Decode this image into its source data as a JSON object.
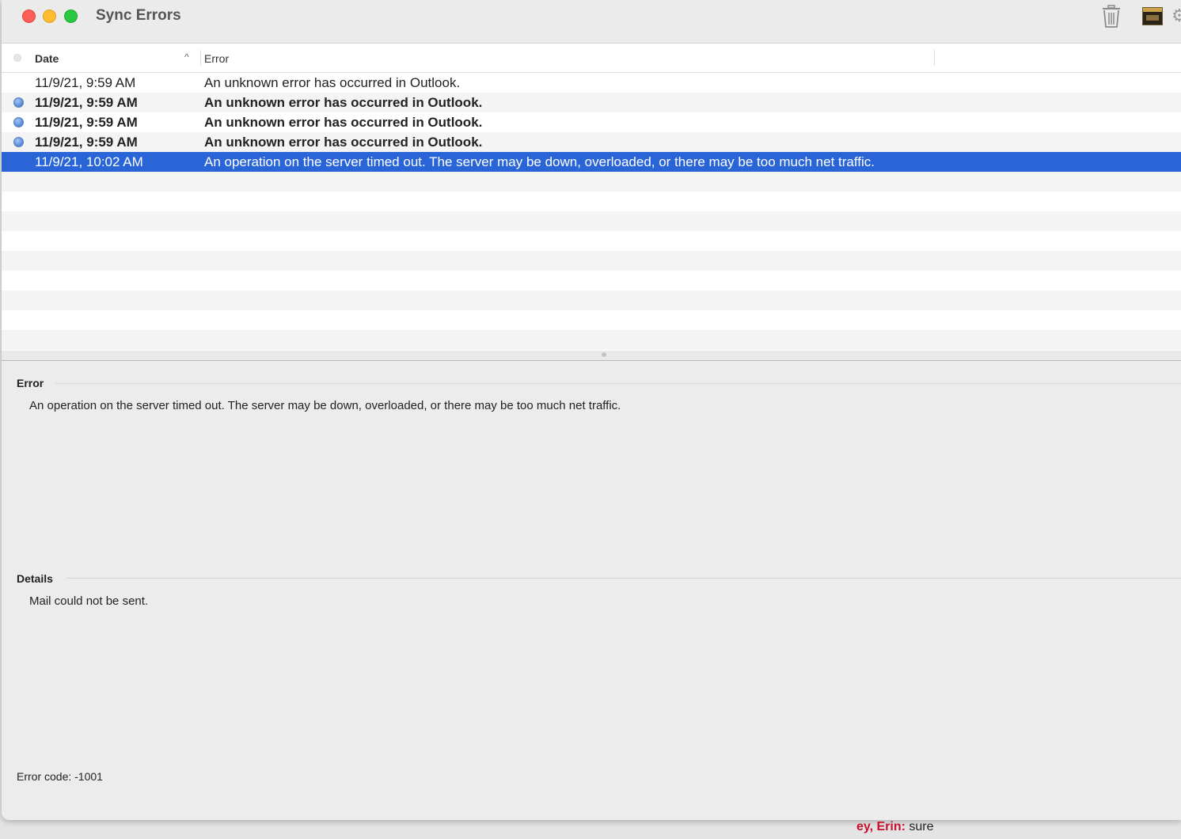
{
  "window": {
    "title": "Sync Errors"
  },
  "toolbar": {
    "icons": [
      "trash-icon",
      "thumbnail-icon",
      "gear-icon"
    ]
  },
  "table": {
    "columns": {
      "date": "Date",
      "error": "Error",
      "sort_indicator": "^"
    },
    "rows": [
      {
        "date": "11/9/21, 9:59 AM",
        "error": "An unknown error has occurred in Outlook.",
        "unread": false,
        "selected": false
      },
      {
        "date": "11/9/21, 9:59 AM",
        "error": "An unknown error has occurred in Outlook.",
        "unread": true,
        "selected": false
      },
      {
        "date": "11/9/21, 9:59 AM",
        "error": "An unknown error has occurred in Outlook.",
        "unread": true,
        "selected": false
      },
      {
        "date": "11/9/21, 9:59 AM",
        "error": "An unknown error has occurred in Outlook.",
        "unread": true,
        "selected": false
      },
      {
        "date": "11/9/21, 10:02 AM",
        "error": "An operation on the server timed out. The server may be down, overloaded, or there may be too much net traffic.",
        "unread": false,
        "selected": true
      }
    ]
  },
  "detail": {
    "error_heading": "Error",
    "error_text": "An operation on the server timed out. The server may be down, overloaded, or there may be too much net traffic.",
    "details_heading": "Details",
    "details_text": "Mail could not be sent.",
    "error_code": "Error code: -1001"
  },
  "background": {
    "sender": "ey, Erin:",
    "message": " sure"
  },
  "colors": {
    "selection": "#2a65d8",
    "unread_dot": "#5a8fdc",
    "close": "#fe5f57",
    "minimize": "#febc2e",
    "zoom": "#28c840"
  }
}
